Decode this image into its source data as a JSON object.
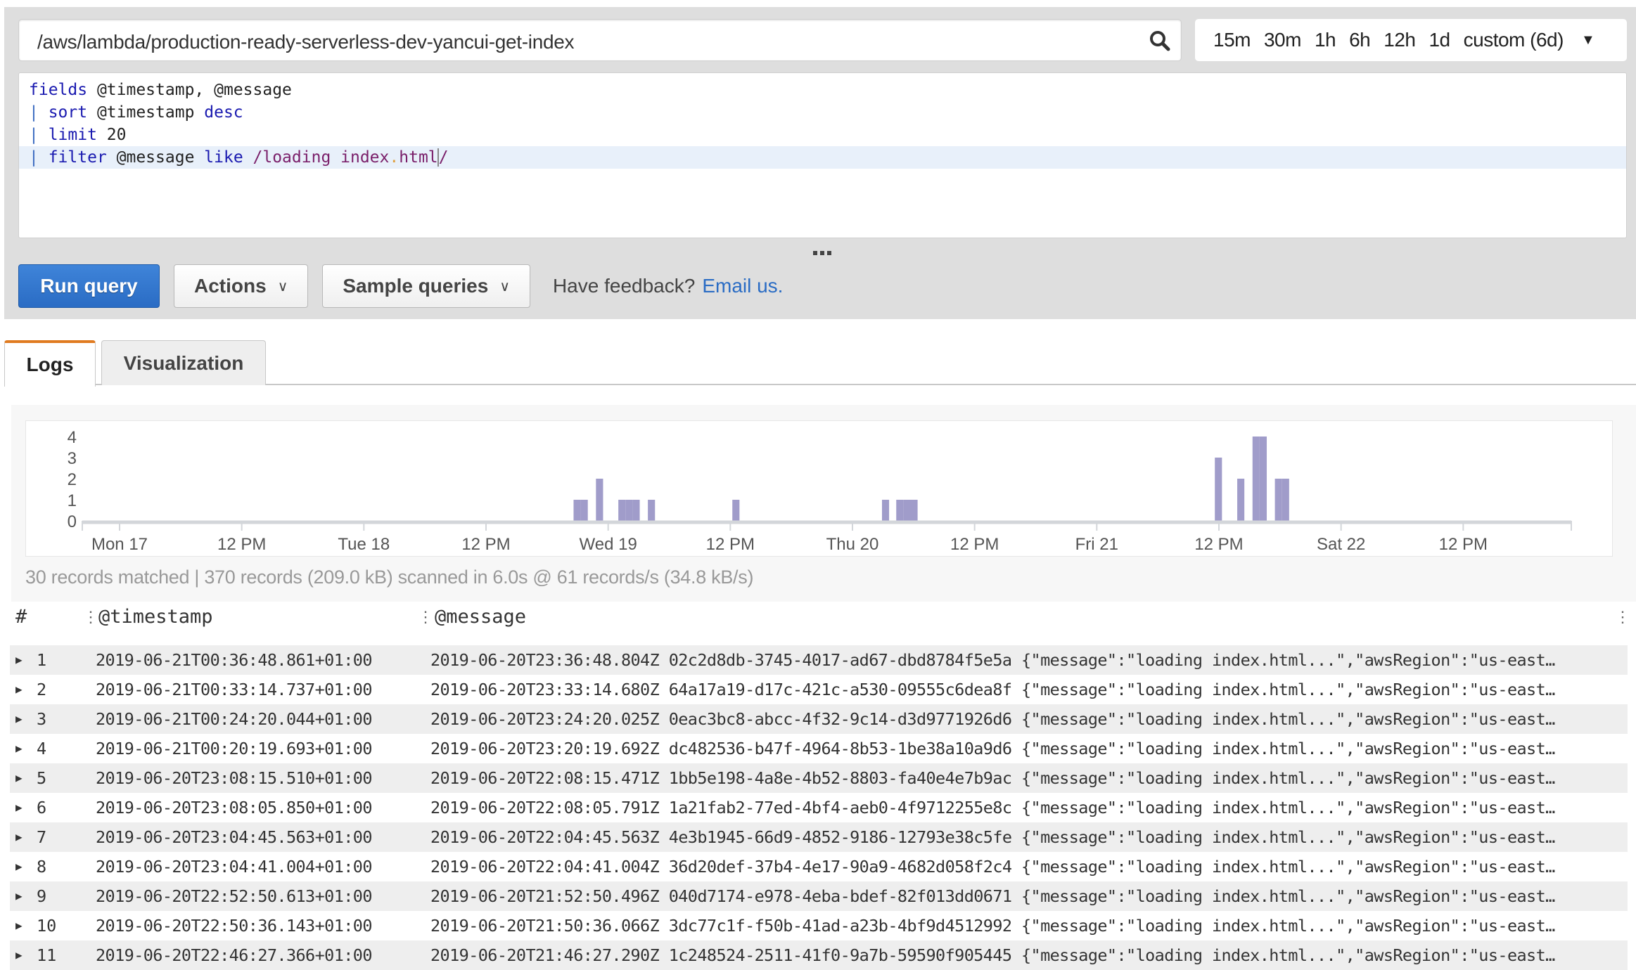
{
  "query_bar": {
    "log_group": "/aws/lambda/production-ready-serverless-dev-yancui-get-index",
    "search_icon": "search-icon",
    "time_options": [
      "15m",
      "30m",
      "1h",
      "6h",
      "12h",
      "1d",
      "custom (6d)"
    ],
    "time_caret_icon": "caret-down-icon"
  },
  "editor": {
    "lines": [
      [
        {
          "t": "fields",
          "c": "kw"
        },
        {
          "t": " @timestamp, @message",
          "c": "at"
        }
      ],
      [
        {
          "t": "| ",
          "c": "pipe"
        },
        {
          "t": "sort",
          "c": "kw"
        },
        {
          "t": " @timestamp ",
          "c": "at"
        },
        {
          "t": "desc",
          "c": "kw"
        }
      ],
      [
        {
          "t": "| ",
          "c": "pipe"
        },
        {
          "t": "limit",
          "c": "kw"
        },
        {
          "t": " 20",
          "c": "num"
        }
      ],
      [
        {
          "t": "| ",
          "c": "pipe"
        },
        {
          "t": "filter",
          "c": "kw"
        },
        {
          "t": " @message ",
          "c": "at"
        },
        {
          "t": "like",
          "c": "kw"
        },
        {
          "t": " /loading index",
          "c": "re"
        },
        {
          "t": ".",
          "c": "dot"
        },
        {
          "t": "html",
          "c": "re"
        },
        {
          "t": "",
          "c": "cursor"
        },
        {
          "t": "/",
          "c": "re"
        }
      ]
    ],
    "active_line": 3
  },
  "buttons": {
    "run_query": "Run query",
    "actions": "Actions",
    "sample_queries": "Sample queries",
    "chevron_icon": "chevron-down-icon"
  },
  "feedback": {
    "text": "Have feedback?",
    "link": "Email us."
  },
  "tabs": [
    {
      "label": "Logs",
      "active": true
    },
    {
      "label": "Visualization",
      "active": false
    }
  ],
  "stats": "30 records matched | 370 records (209.0 kB) scanned in 6.0s @ 61 records/s (34.8 kB/s)",
  "chart_data": {
    "type": "bar",
    "title": "",
    "xlabel": "",
    "ylabel": "",
    "ylim": [
      0,
      4
    ],
    "yticks": [
      "0",
      "1",
      "2",
      "3",
      "4"
    ],
    "x_unit": "hours since Mon 17 00:00",
    "xlim": [
      0,
      144
    ],
    "xticks": [
      {
        "label": "Mon 17",
        "x": 0
      },
      {
        "label": "12 PM",
        "x": 12
      },
      {
        "label": "Tue 18",
        "x": 24
      },
      {
        "label": "12 PM",
        "x": 36
      },
      {
        "label": "Wed 19",
        "x": 48
      },
      {
        "label": "12 PM",
        "x": 60
      },
      {
        "label": "Thu 20",
        "x": 72
      },
      {
        "label": "12 PM",
        "x": 84
      },
      {
        "label": "Fri 21",
        "x": 96
      },
      {
        "label": "12 PM",
        "x": 108
      },
      {
        "label": "Sat 22",
        "x": 120
      },
      {
        "label": "12 PM",
        "x": 132
      }
    ],
    "bar_width_hours": 0.7,
    "x": [
      44.6,
      45.3,
      46.8,
      49.0,
      49.7,
      50.4,
      51.9,
      60.2,
      74.9,
      76.3,
      77.0,
      77.7,
      107.6,
      109.8,
      111.3,
      112.0,
      113.5,
      114.2
    ],
    "values": [
      1,
      1,
      2,
      1,
      1,
      1,
      1,
      1,
      1,
      1,
      1,
      1,
      3,
      2,
      4,
      4,
      2,
      2
    ],
    "bar_color": "#a09cca",
    "grid": false
  },
  "table": {
    "columns": [
      "#",
      "@timestamp",
      "@message"
    ],
    "column_menu_icon": "column-menu-icon",
    "rows": [
      {
        "n": "1",
        "ts": "2019-06-21T00:36:48.861+01:00",
        "msg": "2019-06-20T23:36:48.804Z 02c2d8db-3745-4017-ad67-dbd8784f5e5a {\"message\":\"loading index.html...\",\"awsRegion\":\"us-east…"
      },
      {
        "n": "2",
        "ts": "2019-06-21T00:33:14.737+01:00",
        "msg": "2019-06-20T23:33:14.680Z 64a17a19-d17c-421c-a530-09555c6dea8f {\"message\":\"loading index.html...\",\"awsRegion\":\"us-east…"
      },
      {
        "n": "3",
        "ts": "2019-06-21T00:24:20.044+01:00",
        "msg": "2019-06-20T23:24:20.025Z 0eac3bc8-abcc-4f32-9c14-d3d9771926d6 {\"message\":\"loading index.html...\",\"awsRegion\":\"us-east…"
      },
      {
        "n": "4",
        "ts": "2019-06-21T00:20:19.693+01:00",
        "msg": "2019-06-20T23:20:19.692Z dc482536-b47f-4964-8b53-1be38a10a9d6 {\"message\":\"loading index.html...\",\"awsRegion\":\"us-east…"
      },
      {
        "n": "5",
        "ts": "2019-06-20T23:08:15.510+01:00",
        "msg": "2019-06-20T22:08:15.471Z 1bb5e198-4a8e-4b52-8803-fa40e4e7b9ac {\"message\":\"loading index.html...\",\"awsRegion\":\"us-east…"
      },
      {
        "n": "6",
        "ts": "2019-06-20T23:08:05.850+01:00",
        "msg": "2019-06-20T22:08:05.791Z 1a21fab2-77ed-4bf4-aeb0-4f9712255e8c {\"message\":\"loading index.html...\",\"awsRegion\":\"us-east…"
      },
      {
        "n": "7",
        "ts": "2019-06-20T23:04:45.563+01:00",
        "msg": "2019-06-20T22:04:45.563Z 4e3b1945-66d9-4852-9186-12793e38c5fe {\"message\":\"loading index.html...\",\"awsRegion\":\"us-east…"
      },
      {
        "n": "8",
        "ts": "2019-06-20T23:04:41.004+01:00",
        "msg": "2019-06-20T22:04:41.004Z 36d20def-37b4-4e17-90a9-4682d058f2c4 {\"message\":\"loading index.html...\",\"awsRegion\":\"us-east…"
      },
      {
        "n": "9",
        "ts": "2019-06-20T22:52:50.613+01:00",
        "msg": "2019-06-20T21:52:50.496Z 040d7174-e978-4eba-bdef-82f013dd0671 {\"message\":\"loading index.html...\",\"awsRegion\":\"us-east…"
      },
      {
        "n": "10",
        "ts": "2019-06-20T22:50:36.143+01:00",
        "msg": "2019-06-20T21:50:36.066Z 3dc77c1f-f50b-41ad-a23b-4bf9d4512992 {\"message\":\"loading index.html...\",\"awsRegion\":\"us-east…"
      },
      {
        "n": "11",
        "ts": "2019-06-20T22:46:27.366+01:00",
        "msg": "2019-06-20T21:46:27.290Z 1c248524-2511-41f0-9a7b-59590f905445 {\"message\":\"loading index.html...\",\"awsRegion\":\"us-east…"
      }
    ]
  },
  "colors": {
    "primary_button": "#2a6cc4",
    "active_tab_accent": "#e07b20",
    "link": "#2a6cc4",
    "panel_bg": "#dedede"
  }
}
